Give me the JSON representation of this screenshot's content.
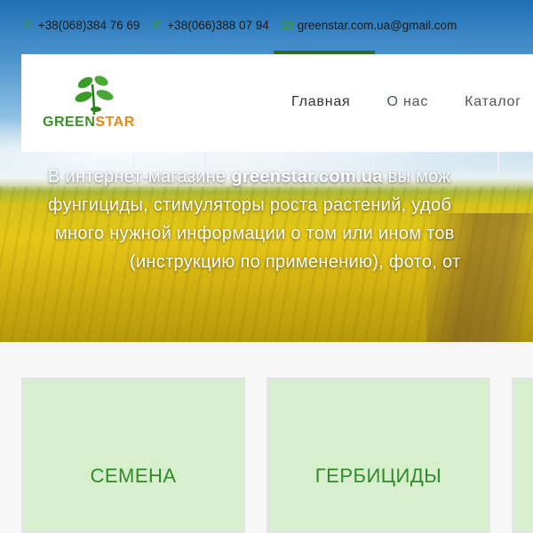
{
  "contacts": {
    "phone1": "+38(068)384 76 69",
    "phone2": "+38(066)388 07 94",
    "email": "greenstar.com.ua@gmail.com"
  },
  "logo": {
    "part1": "GREEN",
    "part2": "STAR"
  },
  "nav": {
    "items": [
      "Главная",
      "О нас",
      "Каталог"
    ]
  },
  "hero": {
    "line1_pre": "В интернет-магазине ",
    "line1_bold": "greenstar.com.ua",
    "line1_post": " вы мож",
    "line2": "фунгициды, стимуляторы роста растений, удоб",
    "line3": "много нужной информации о том или ином тов",
    "line4": "(инструкцию по применению), фото, от"
  },
  "categories": [
    "СЕМЕНА",
    "ГЕРБИЦИДЫ",
    ""
  ],
  "colors": {
    "accent_green": "#2e6b25",
    "card_bg": "#d8efcd",
    "category_text": "#2f8a2a",
    "logo_orange": "#e08a1c"
  }
}
